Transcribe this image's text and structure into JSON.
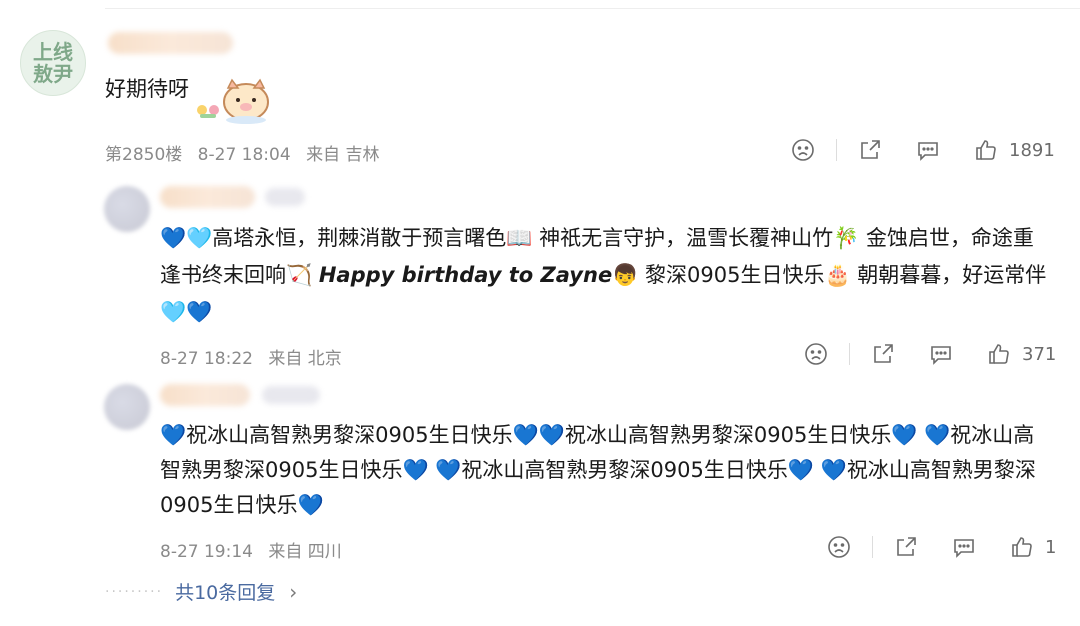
{
  "comment": {
    "avatar_text": "上线敖尹",
    "text": "好期待呀",
    "sticker": "pig-sticker",
    "meta": {
      "floor": "第2850楼",
      "time": "8-27 18:04",
      "location": "来自 吉林"
    },
    "likes": "1891"
  },
  "replies": [
    {
      "text_before": "💙🩵高塔永恒，荆棘消散于预言曙色📖 神祇无言守护，温雪长覆神山竹🎋 金蚀启世，命途重逢书终末回响🏹 ",
      "text_en": "Happy birthday to Zayne",
      "text_after": "👦 黎深0905生日快乐🎂 朝朝暮暮，好运常伴🩵💙",
      "meta": {
        "time": "8-27 18:22",
        "location": "来自 北京"
      },
      "likes": "371"
    },
    {
      "text": "💙祝冰山高智熟男黎深0905生日快乐💙💙祝冰山高智熟男黎深0905生日快乐💙 💙祝冰山高智熟男黎深0905生日快乐💙 💙祝冰山高智熟男黎深0905生日快乐💙 💙祝冰山高智熟男黎深0905生日快乐💙",
      "meta": {
        "time": "8-27 19:14",
        "location": "来自 四川"
      },
      "likes": "1"
    }
  ],
  "more_replies": "共10条回复",
  "colors": {
    "text": "#1a1a1a",
    "meta": "#8a8a8a",
    "link": "#4a6aa0",
    "heart_blue": "#2f7be6",
    "heart_cyan": "#5ecfe8"
  }
}
